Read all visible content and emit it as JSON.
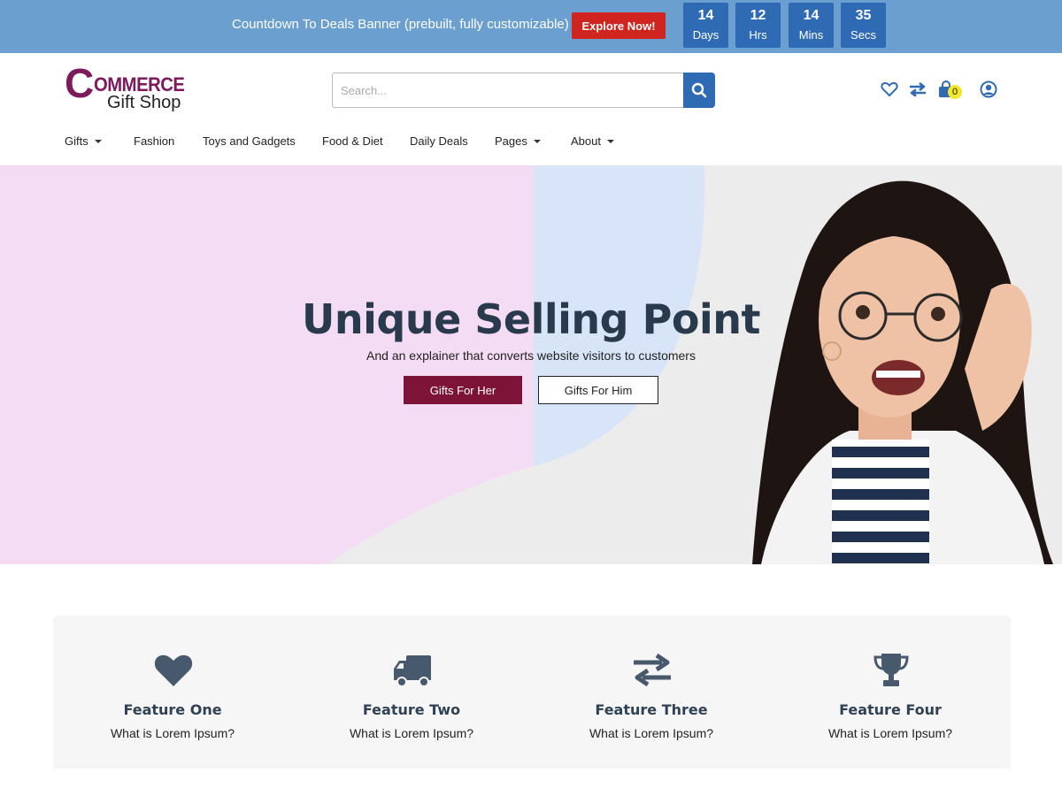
{
  "banner": {
    "text": "Countdown To Deals Banner (prebuilt, fully customizable)",
    "button_label": "Explore Now!",
    "countdown": [
      {
        "value": "14",
        "label": "Days"
      },
      {
        "value": "12",
        "label": "Hrs"
      },
      {
        "value": "14",
        "label": "Mins"
      },
      {
        "value": "35",
        "label": "Secs"
      }
    ]
  },
  "logo": {
    "initial": "C",
    "word": "OMMERCE",
    "subtitle": "Gift Shop"
  },
  "search": {
    "placeholder": "Search...",
    "value": ""
  },
  "header_icons": {
    "wishlist": "heart-icon",
    "compare": "compare-arrows-icon",
    "cart": "shopping-bag-icon",
    "cart_count": "0",
    "account": "user-circle-icon"
  },
  "nav": {
    "items": [
      {
        "label": "Gifts",
        "dropdown": true
      },
      {
        "label": "Fashion",
        "dropdown": false
      },
      {
        "label": "Toys and Gadgets",
        "dropdown": false
      },
      {
        "label": "Food & Diet",
        "dropdown": false
      },
      {
        "label": "Daily Deals",
        "dropdown": false
      },
      {
        "label": "Pages",
        "dropdown": true
      },
      {
        "label": "About",
        "dropdown": true
      }
    ]
  },
  "hero": {
    "title": "Unique Selling Point",
    "subtitle": "And an explainer that converts website visitors to customers",
    "primary_button": "Gifts For Her",
    "secondary_button": "Gifts For Him",
    "colors": {
      "pink": "#f4ddf4",
      "blue": "#d8e4f7",
      "grey": "#ececec"
    }
  },
  "features": [
    {
      "icon": "heart-icon",
      "title": "Feature One",
      "text": "What is Lorem Ipsum?"
    },
    {
      "icon": "truck-icon",
      "title": "Feature Two",
      "text": "What is Lorem Ipsum?"
    },
    {
      "icon": "exchange-arrows-icon",
      "title": "Feature Three",
      "text": "What is Lorem Ipsum?"
    },
    {
      "icon": "trophy-icon",
      "title": "Feature Four",
      "text": "What is Lorem Ipsum?"
    }
  ],
  "colors": {
    "banner_bg": "#6a9fcf",
    "accent_blue": "#2f6bb5",
    "cta_red": "#d0241f",
    "brand_purple": "#7d1a5b",
    "hero_button": "#7d1437",
    "feature_text": "#2f4154"
  }
}
